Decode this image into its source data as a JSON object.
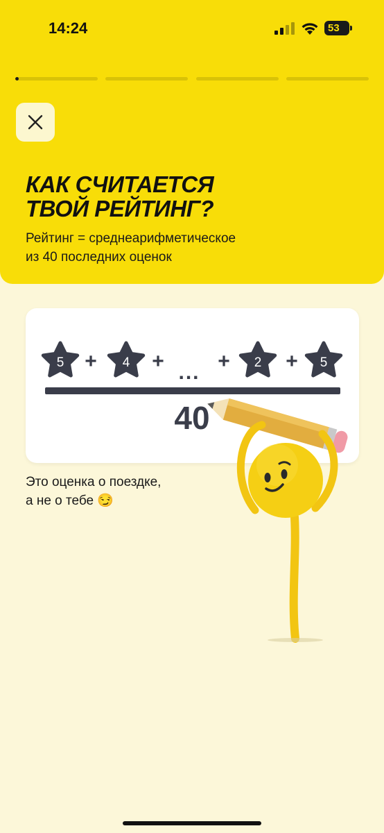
{
  "status_bar": {
    "time": "14:24",
    "battery_level": "53",
    "battery_fraction": 0.53
  },
  "progress": {
    "segments": 4,
    "current_segment_fill": 0.04
  },
  "header": {
    "close_icon": "close-icon",
    "title_line1": "КАК СЧИТАЕТСЯ",
    "title_line2": "ТВОЙ РЕЙТИНГ?",
    "subtitle_line1": "Рейтинг = среднеарифметическое",
    "subtitle_line2": "из 40 последних оценок"
  },
  "formula": {
    "stars": [
      "5",
      "4",
      "2",
      "5"
    ],
    "plus": "+",
    "ellipsis": "...",
    "denominator": "40"
  },
  "caption": {
    "line1": "Это оценка о поездке,",
    "line2": "а не о тебе 😏"
  },
  "colors": {
    "accent_yellow": "#f8dd08",
    "background": "#fcf7d9",
    "star_fill": "#3a3d4a",
    "pencil": "#e2ad3f"
  }
}
